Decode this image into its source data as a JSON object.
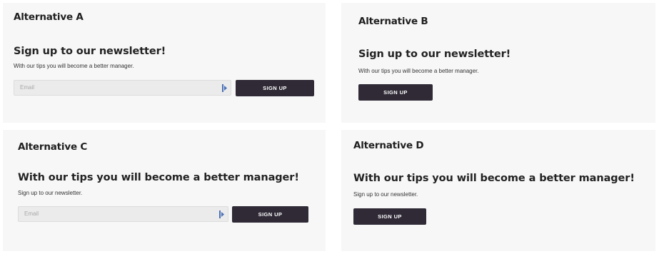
{
  "panels": {
    "a": {
      "title": "Alternative A",
      "headline": "Sign up to our newsletter!",
      "subtext": "With our tips you will become a better manager.",
      "email_placeholder": "Email",
      "button_label": "SIGN UP"
    },
    "b": {
      "title": "Alternative B",
      "headline": "Sign up to our newsletter!",
      "subtext": "With our tips you will become a better manager.",
      "button_label": "SIGN UP"
    },
    "c": {
      "title": "Alternative C",
      "headline": "With our tips you will become a better manager!",
      "subtext": "Sign up to our newsletter.",
      "email_placeholder": "Email",
      "button_label": "SIGN UP"
    },
    "d": {
      "title": "Alternative D",
      "headline": "With our tips you will become a better manager!",
      "subtext": "Sign up to our newsletter.",
      "button_label": "SIGN UP"
    }
  },
  "colors": {
    "button_bg": "#2f2a36",
    "panel_bg": "#f7f7f7",
    "field_bg": "#ebebeb",
    "icon_accent": "#4a6fb5"
  }
}
